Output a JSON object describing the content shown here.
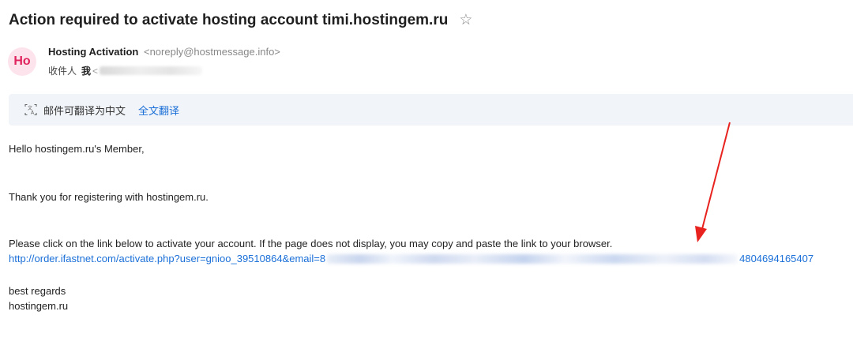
{
  "email": {
    "subject": "Action required to activate hosting account timi.hostingem.ru",
    "sender": {
      "avatar_text": "Ho",
      "name": "Hosting Activation",
      "email": "<noreply@hostmessage.info>"
    },
    "recipient": {
      "label": "收件人",
      "me": "我",
      "email_prefix": "<"
    },
    "translate_bar": {
      "notice": "邮件可翻译为中文",
      "action": "全文翻译"
    },
    "body": {
      "greeting": "Hello hostingem.ru's Member,",
      "thanks": "Thank you for registering with hostingem.ru.",
      "instruction": "Please click on the link below to activate your account. If the page does not display, you may copy and paste the link to your browser.",
      "link_start": "http://order.ifastnet.com/activate.php?user=gnioo_39510864&email=8",
      "link_end": "4804694165407",
      "closing": "best regards",
      "signature": "hostingem.ru"
    }
  },
  "colors": {
    "link": "#1a6fd8",
    "avatar_bg": "#fde3ec",
    "avatar_fg": "#e0245e",
    "annotation_arrow": "#e8231f"
  },
  "icons": [
    "star-icon",
    "translate-icon",
    "annotation-arrow"
  ]
}
